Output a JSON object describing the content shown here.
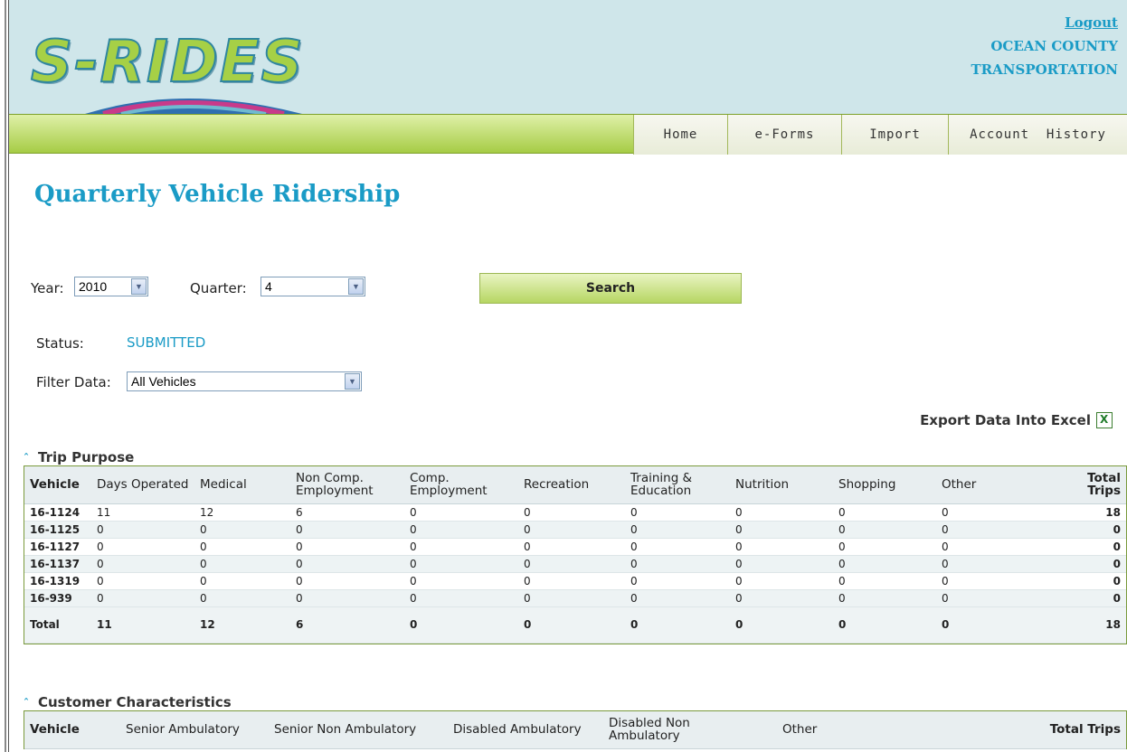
{
  "header": {
    "logo_text": "S-RIDES",
    "logout": "Logout",
    "org_line1": "OCEAN COUNTY",
    "org_line2": "TRANSPORTATION"
  },
  "nav": {
    "items": [
      {
        "label": "Home"
      },
      {
        "label": "e-Forms"
      },
      {
        "label": "Import"
      },
      {
        "label": "Account  History"
      }
    ]
  },
  "page": {
    "title": "Quarterly Vehicle Ridership"
  },
  "filters": {
    "year_label": "Year:",
    "year_value": "2010",
    "quarter_label": "Quarter:",
    "quarter_value": "4",
    "search_label": "Search",
    "status_label": "Status:",
    "status_value": "SUBMITTED",
    "filter_label": "Filter Data:",
    "filter_value": "All Vehicles"
  },
  "export": {
    "label": "Export Data Into Excel",
    "icon": "excel-icon"
  },
  "trip_purpose": {
    "title": "Trip Purpose",
    "headers": [
      "Vehicle",
      "Days Operated",
      "Medical",
      "Non Comp. Employment",
      "Comp. Employment",
      "Recreation",
      "Training & Education",
      "Nutrition",
      "Shopping",
      "Other",
      "Total Trips"
    ],
    "rows": [
      [
        "16-1124",
        "11",
        "12",
        "6",
        "0",
        "0",
        "0",
        "0",
        "0",
        "0",
        "18"
      ],
      [
        "16-1125",
        "0",
        "0",
        "0",
        "0",
        "0",
        "0",
        "0",
        "0",
        "0",
        "0"
      ],
      [
        "16-1127",
        "0",
        "0",
        "0",
        "0",
        "0",
        "0",
        "0",
        "0",
        "0",
        "0"
      ],
      [
        "16-1137",
        "0",
        "0",
        "0",
        "0",
        "0",
        "0",
        "0",
        "0",
        "0",
        "0"
      ],
      [
        "16-1319",
        "0",
        "0",
        "0",
        "0",
        "0",
        "0",
        "0",
        "0",
        "0",
        "0"
      ],
      [
        "16-939",
        "0",
        "0",
        "0",
        "0",
        "0",
        "0",
        "0",
        "0",
        "0",
        "0"
      ]
    ],
    "total": [
      "Total",
      "11",
      "12",
      "6",
      "0",
      "0",
      "0",
      "0",
      "0",
      "0",
      "18"
    ]
  },
  "customer_characteristics": {
    "title": "Customer Characteristics",
    "headers": [
      "Vehicle",
      "Senior Ambulatory",
      "Senior Non Ambulatory",
      "Disabled Ambulatory",
      "Disabled Non Ambulatory",
      "Other",
      "Total Trips"
    ]
  }
}
